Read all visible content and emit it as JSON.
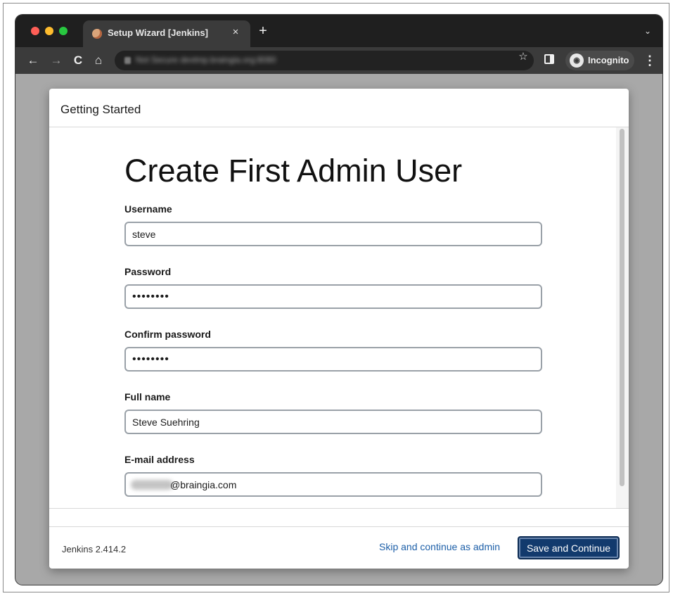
{
  "browser": {
    "tab_title": "Setup Wizard [Jenkins]",
    "tab_close": "×",
    "new_tab": "+",
    "tab_menu": "⌄",
    "nav": {
      "back": "←",
      "forward": "→",
      "reload": "C",
      "home": "⌂"
    },
    "url_blurred": "Not Secure   devtmp.braingia.org:8080",
    "star": "☆",
    "incognito_label": "Incognito",
    "incognito_icon": "incognito-icon",
    "menu": "⋮"
  },
  "dialog": {
    "header_title": "Getting Started",
    "heading": "Create First Admin User",
    "fields": {
      "username": {
        "label": "Username",
        "value": "steve"
      },
      "password": {
        "label": "Password",
        "value": "••••••••"
      },
      "confirm_password": {
        "label": "Confirm password",
        "value": "••••••••"
      },
      "full_name": {
        "label": "Full name",
        "value": "Steve Suehring"
      },
      "email": {
        "label": "E-mail address",
        "domain": "@braingia.com"
      }
    },
    "footer": {
      "version": "Jenkins 2.414.2",
      "skip_link": "Skip and continue as admin",
      "save_button": "Save and Continue"
    }
  },
  "colors": {
    "primary_button": "#123a6d",
    "link": "#1d5fa8",
    "browser_chrome": "#1f1f1f",
    "backdrop": "#a8a8a8"
  }
}
